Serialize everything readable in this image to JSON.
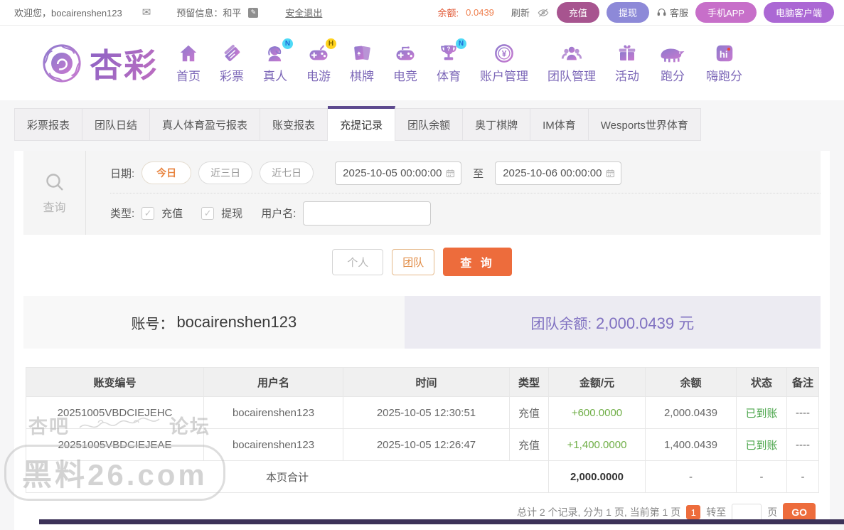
{
  "topbar": {
    "welcome": "欢迎您，bocairenshen123",
    "reserved_label": "预留信息：和平",
    "logout": "安全退出",
    "balance_label": "余额:",
    "balance_value": "0.0439",
    "refresh_label": "刷新",
    "recharge": "充值",
    "withdraw": "提现",
    "service": "客服",
    "mobile_app": "手机APP",
    "pc_client": "电脑客户端"
  },
  "nav": {
    "logo_text": "杏彩",
    "items": [
      {
        "label": "首页",
        "badge": ""
      },
      {
        "label": "彩票",
        "badge": ""
      },
      {
        "label": "真人",
        "badge": "N"
      },
      {
        "label": "电游",
        "badge": "H"
      },
      {
        "label": "棋牌",
        "badge": ""
      },
      {
        "label": "电竞",
        "badge": ""
      },
      {
        "label": "体育",
        "badge": "N"
      },
      {
        "label": "账户管理",
        "badge": ""
      },
      {
        "label": "团队管理",
        "badge": ""
      },
      {
        "label": "活动",
        "badge": ""
      },
      {
        "label": "跑分",
        "badge": ""
      },
      {
        "label": "嗨跑分",
        "badge": ""
      }
    ]
  },
  "tabs": [
    {
      "label": "彩票报表",
      "active": false
    },
    {
      "label": "团队日结",
      "active": false
    },
    {
      "label": "真人体育盈亏报表",
      "active": false
    },
    {
      "label": "账变报表",
      "active": false
    },
    {
      "label": "充提记录",
      "active": true
    },
    {
      "label": "团队余额",
      "active": false
    },
    {
      "label": "奥丁棋牌",
      "active": false
    },
    {
      "label": "IM体育",
      "active": false
    },
    {
      "label": "Wesports世界体育",
      "active": false
    }
  ],
  "filter": {
    "side_title": "查询",
    "date_label": "日期:",
    "date_presets": [
      "今日",
      "近三日",
      "近七日"
    ],
    "active_preset": "今日",
    "date_from": "2025-10-05 00:00:00",
    "to_label": "至",
    "date_to": "2025-10-06 00:00:00",
    "type_label": "类型:",
    "type_options": [
      "充值",
      "提现"
    ],
    "username_label": "用户名:",
    "username_value": "",
    "personal_btn": "个人",
    "team_btn": "团队",
    "search_btn": "查 询"
  },
  "account": {
    "label": "账号：",
    "value": "bocairenshen123",
    "team_balance_label": "团队余额:",
    "team_balance_value": "2,000.0439 元"
  },
  "table": {
    "headers": [
      "账变编号",
      "用户名",
      "时间",
      "类型",
      "金额/元",
      "余额",
      "状态",
      "备注"
    ],
    "rows": [
      {
        "id": "20251005VBDCIEJEHC",
        "user": "bocairenshen123",
        "time": "2025-10-05 12:30:51",
        "type": "充值",
        "amount": "+600.0000",
        "balance": "2,000.0439",
        "status": "已到账",
        "remark": "----"
      },
      {
        "id": "20251005VBDCIEJEAE",
        "user": "bocairenshen123",
        "time": "2025-10-05 12:26:47",
        "type": "充值",
        "amount": "+1,400.0000",
        "balance": "1,400.0439",
        "status": "已到账",
        "remark": "----"
      }
    ],
    "summary": {
      "label": "本页合计",
      "amount": "2,000.0000",
      "balance": "-",
      "status": "-",
      "remark": "-"
    }
  },
  "pagination": {
    "summary": "总计 2 个记录, 分为 1 页, 当前第 1 页",
    "current_page": "1",
    "goto_label": "转至",
    "page_label": "页",
    "go_btn": "GO"
  },
  "watermark": {
    "part1": "杏吧",
    "part2": "论坛",
    "line2": "黑料26.com"
  },
  "colors": {
    "accent_orange": "#ed6c3c",
    "theme_purple": "#7d68b8",
    "active_tab_border": "#5d4a8f",
    "amount_green": "#6fae46",
    "status_green": "#4aa54a",
    "recharge_btn": "#a7548f",
    "withdraw_btn": "#8d89d8",
    "balance_text": "#e0532f"
  }
}
